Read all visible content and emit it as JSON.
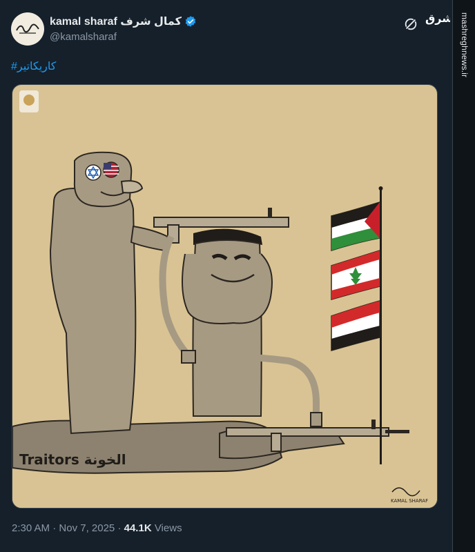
{
  "author": {
    "display_name": "kamal sharaf كمال شرف",
    "handle": "@kamalsharaf",
    "avatar_icon": "signature-logo",
    "verified_icon": "verified-badge-icon"
  },
  "tweet": {
    "hashtag": "#کاریکاتیر",
    "time": "2:30 AM",
    "separator": "·",
    "date": "Nov 7, 2025",
    "views_count": "44.1K",
    "views_label": "Views"
  },
  "cartoon": {
    "caption": "Traitors الخونة",
    "signature": "KAMAL SHARAF",
    "figures": [
      "soldier-with-israel-us-eyes",
      "gas-pump-head-figure",
      "prone-figure-holding-rifle"
    ],
    "flags": [
      "palestine-flag",
      "lebanon-flag",
      "yemen-flag"
    ]
  },
  "overlay": {
    "brand_logo": "مشرق",
    "watermark": "mashreghnews.ir"
  },
  "colors": {
    "background": "#15202b",
    "link": "#1d9bf0",
    "verified": "#1d9bf0",
    "cartoon_bg": "#d9c394"
  }
}
